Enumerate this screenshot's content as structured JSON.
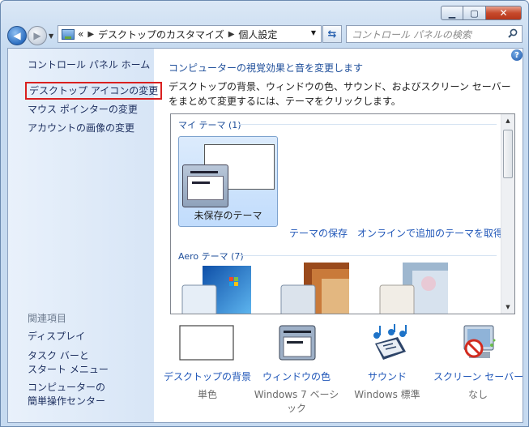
{
  "window": {
    "caption_min": "▁",
    "caption_max": "▢",
    "caption_close": "✕"
  },
  "nav": {
    "breadcrumb_prefix": "«",
    "crumbs": [
      "デスクトップのカスタマイズ",
      "個人設定"
    ],
    "search_placeholder": "コントロール パネルの検索"
  },
  "sidebar": {
    "home": "コントロール パネル ホーム",
    "links": [
      "デスクトップ アイコンの変更",
      "マウス ポインターの変更",
      "アカウントの画像の変更"
    ],
    "related_heading": "関連項目",
    "related": [
      "ディスプレイ",
      "タスク バーと",
      "スタート メニュー",
      "コンピューターの",
      "簡単操作センター"
    ]
  },
  "main": {
    "title": "コンピューターの視覚効果と音を変更します",
    "description": "デスクトップの背景、ウィンドウの色、サウンド、およびスクリーン セーバーをまとめて変更するには、テーマをクリックします。",
    "my_themes": "マイ テーマ (1)",
    "unsaved_theme": "未保存のテーマ",
    "save_theme": "テーマの保存",
    "get_online": "オンラインで追加のテーマを取得",
    "aero_themes": "Aero テーマ (7)"
  },
  "bottom": [
    {
      "label": "デスクトップの背景",
      "sub": "単色",
      "icon": "desktop-background-icon"
    },
    {
      "label": "ウィンドウの色",
      "sub": "Windows 7 ベーシック",
      "icon": "window-color-icon"
    },
    {
      "label": "サウンド",
      "sub": "Windows 標準",
      "icon": "sound-icon"
    },
    {
      "label": "スクリーン セーバー",
      "sub": "なし",
      "icon": "screen-saver-icon"
    }
  ]
}
